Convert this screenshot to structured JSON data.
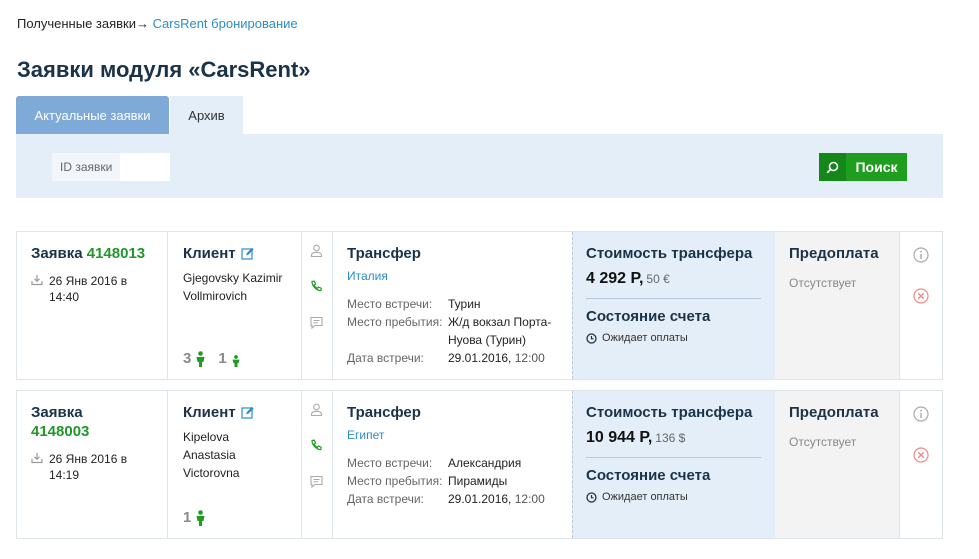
{
  "breadcrumb": {
    "parent": "Полученные заявки",
    "separator": "→",
    "current": "CarsRent бронирование"
  },
  "page_title": "Заявки модуля «CarsRent»",
  "tabs": [
    {
      "label": "Актуальные заявки",
      "active": true
    },
    {
      "label": "Архив",
      "active": false
    }
  ],
  "filter": {
    "id_label": "ID заявки",
    "id_value": "",
    "search_label": "Поиск"
  },
  "labels": {
    "order": "Заявка",
    "client": "Клиент",
    "transfer": "Трансфер",
    "meeting_place": "Место встречи:",
    "arrival_place": "Место пребытия:",
    "meeting_date": "Дата встречи:",
    "cost": "Стоимость трансфера",
    "invoice_state": "Состояние счета",
    "prepayment": "Предоплата"
  },
  "orders": [
    {
      "id": "4148013",
      "date": "26 Янв 2016 в",
      "time": "14:40",
      "client_name": "Gjegovsky Kazimir Vollmirovich",
      "adults": "3",
      "children": "1",
      "country": "Италия",
      "meeting_place": "Турин",
      "arrival_place": "Ж/д вокзал Порта-Нуова (Турин)",
      "meeting_date": "29.01.2016,",
      "meeting_time": "12:00",
      "price_rub": "4 292 Р,",
      "price_alt": "50 €",
      "invoice_status": "Ожидает оплаты",
      "prepayment": "Отсутствует"
    },
    {
      "id": "4148003",
      "date": "26 Янв 2016 в",
      "time": "14:19",
      "client_name": "Kipelova Anastasia Victorovna",
      "adults": "1",
      "children": "",
      "country": "Египет",
      "meeting_place": "Александрия",
      "arrival_place": "Пирамиды",
      "meeting_date": "29.01.2016,",
      "meeting_time": "12:00",
      "price_rub": "10 944 Р,",
      "price_alt": "136 $",
      "invoice_status": "Ожидает оплаты",
      "prepayment": "Отсутствует"
    }
  ],
  "colors": {
    "accent": "#2c8dc6",
    "green": "#21962a",
    "title": "#1a3348",
    "tab_active": "#7fa9d6",
    "panel": "#e4eef8",
    "danger": "#f08a8a"
  },
  "icons": [
    "edit-icon",
    "download-icon",
    "user-icon",
    "phone-icon",
    "chat-icon",
    "adult-icon",
    "child-icon",
    "clock-icon",
    "info-icon",
    "cancel-icon",
    "search-icon"
  ]
}
